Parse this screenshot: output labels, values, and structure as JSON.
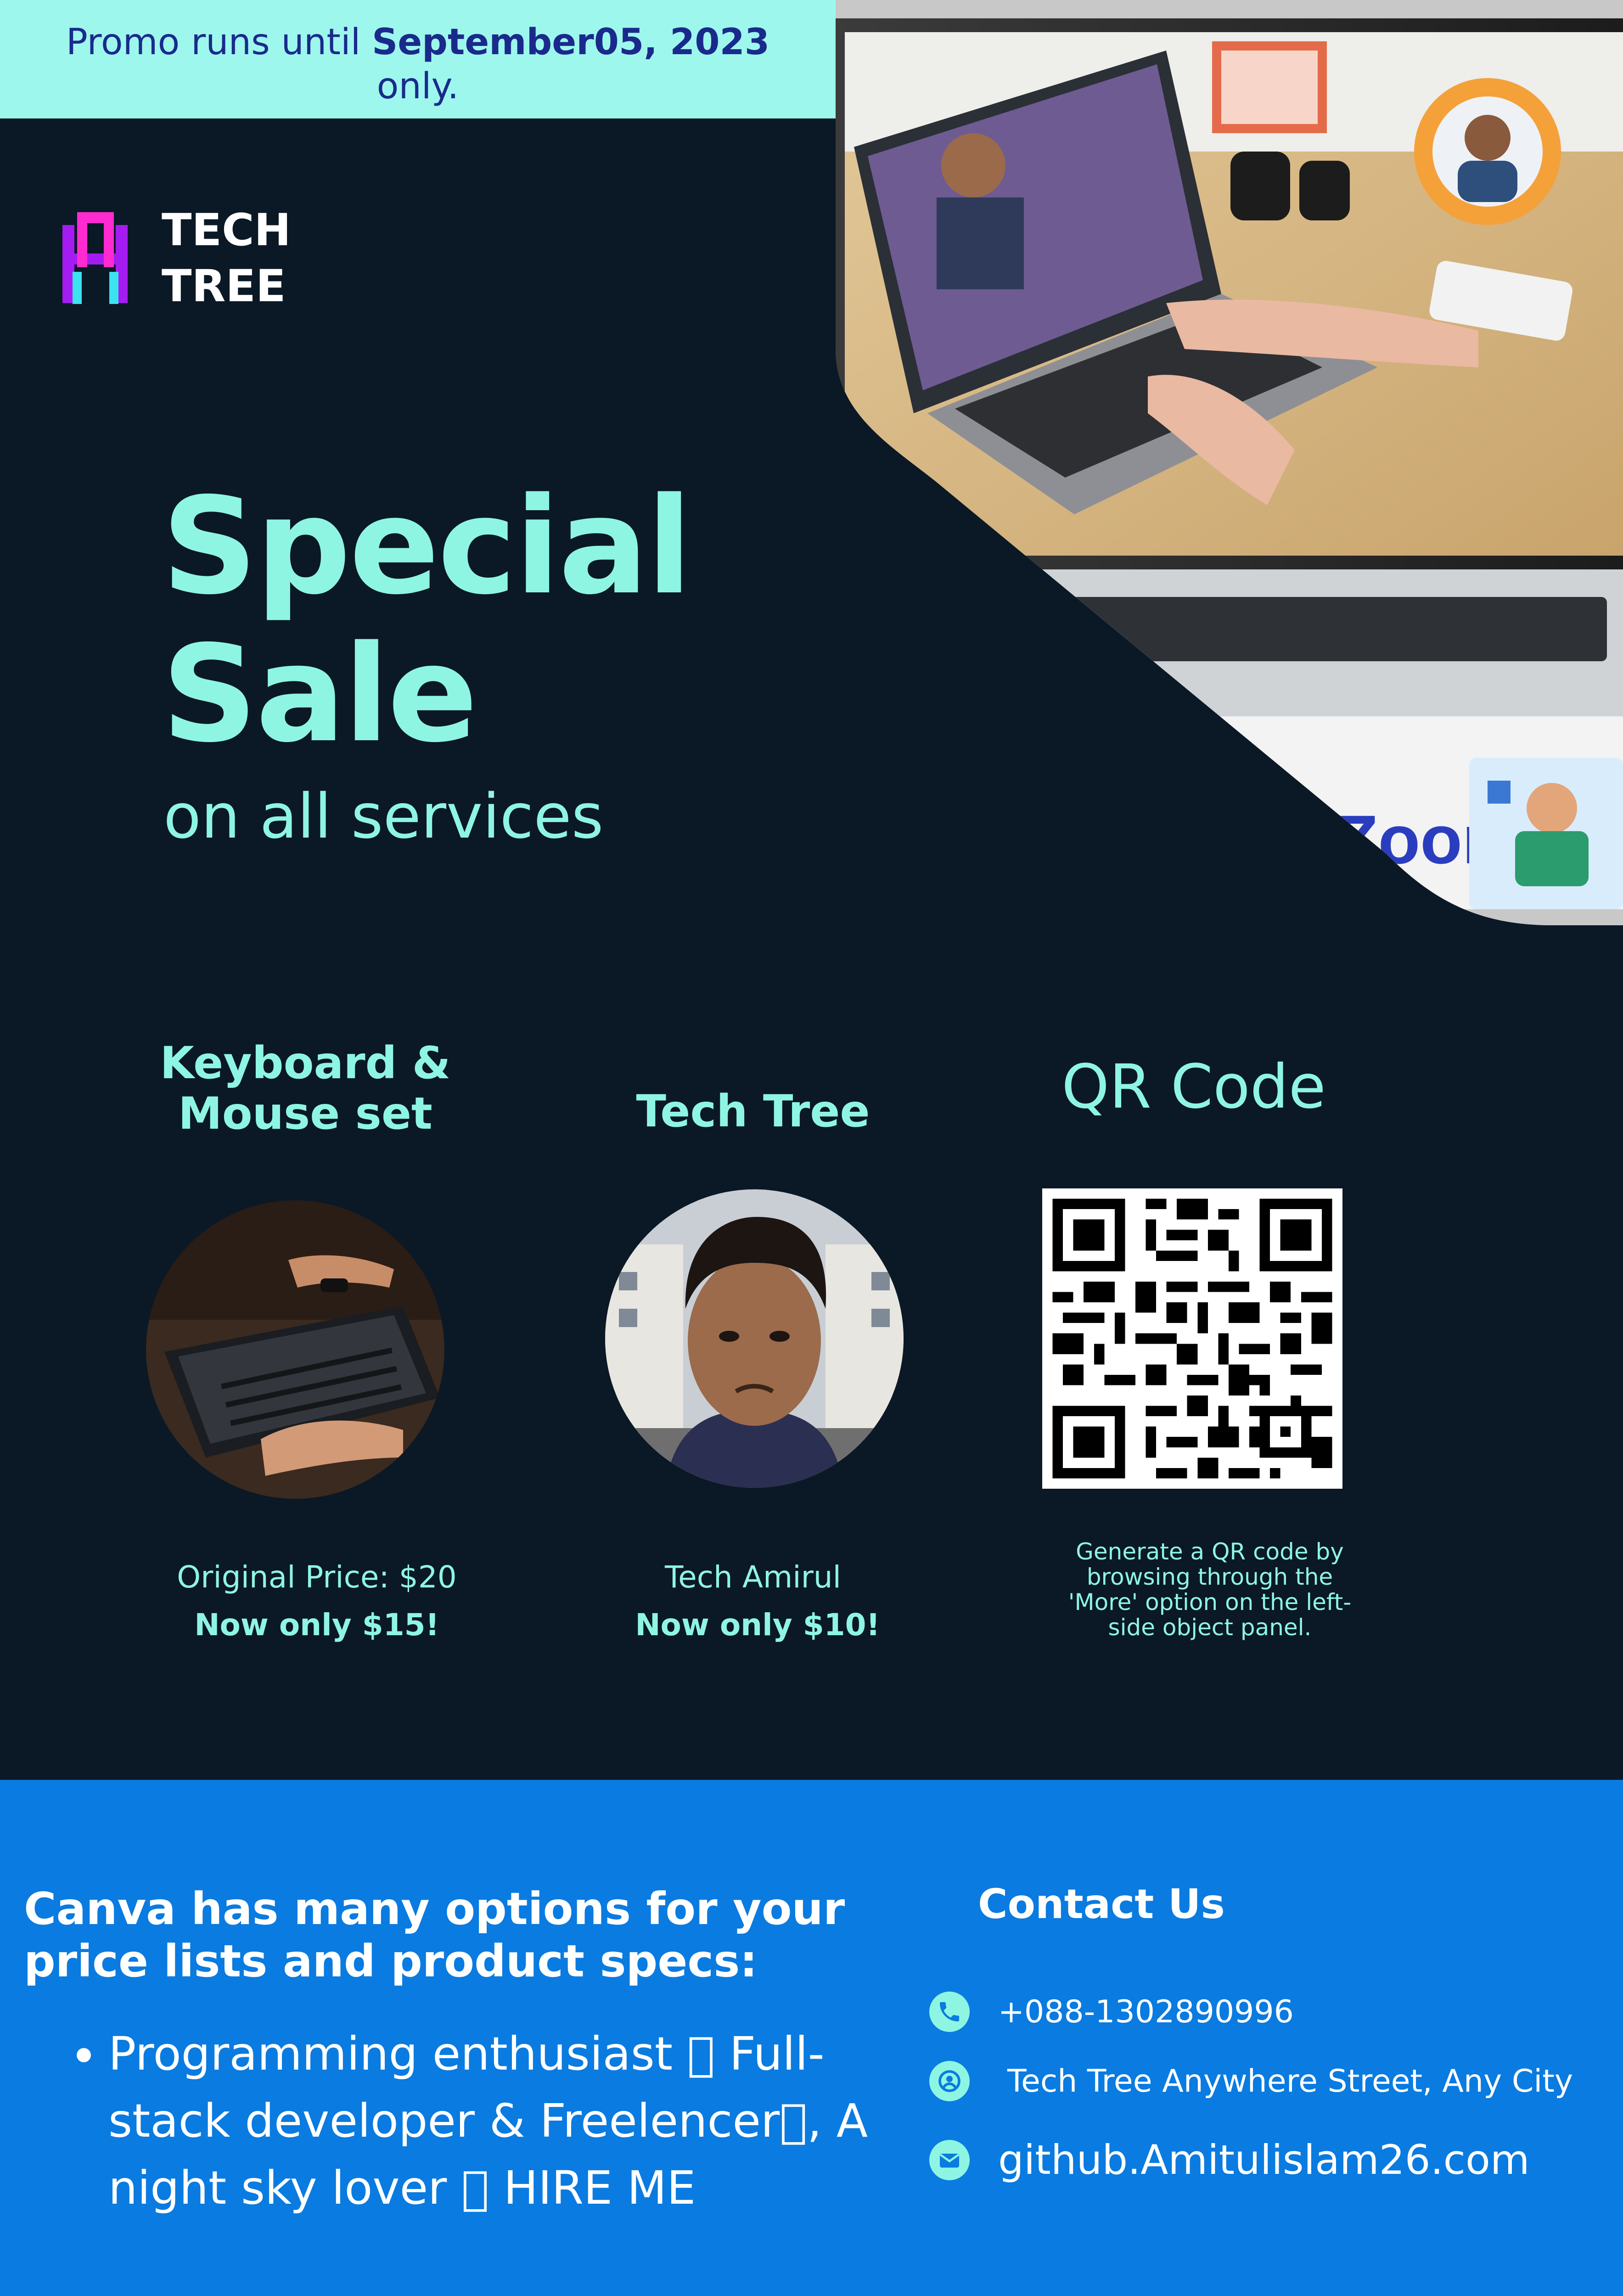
{
  "promo": {
    "prefix": "Promo runs until ",
    "date": "September05, 2023",
    "suffix": "only."
  },
  "brand": {
    "line1": "TECH",
    "line2": "TREE"
  },
  "headline": {
    "line1": "Special",
    "line2": "Sale",
    "subtitle": "on all services"
  },
  "products": [
    {
      "title_line1": "Keyboard &",
      "title_line2": "Mouse set",
      "detail": "Original Price: $20",
      "offer": "Now only $15!"
    },
    {
      "title": "Tech Tree",
      "detail": "Tech Amirul",
      "offer": "Now only $10!"
    }
  ],
  "qr": {
    "title": "QR Code",
    "note": "Generate a QR code by browsing through the 'More' option on the left-side object panel."
  },
  "footer": {
    "title": "Canva has many options for your price lists and product specs:",
    "bullets": [
      "Programming enthusiast 􏰀 Full-stack developer & Freelencer􏰀, A night sky lover 􏰀 HIRE ME"
    ]
  },
  "contact": {
    "title": "Contact Us",
    "phone": "+088-1302890996",
    "address": "Tech Tree Anywhere Street, Any City",
    "web": "github.Amitulislam26.com"
  },
  "colors": {
    "background": "#0b1826",
    "accent": "#8ef5e3",
    "promo_bg": "#9df7ec",
    "footer_bg": "#0a7be0",
    "promo_text": "#1a2a8c"
  },
  "icons": [
    "logo-icon",
    "phone-icon",
    "location-icon",
    "mail-icon"
  ]
}
